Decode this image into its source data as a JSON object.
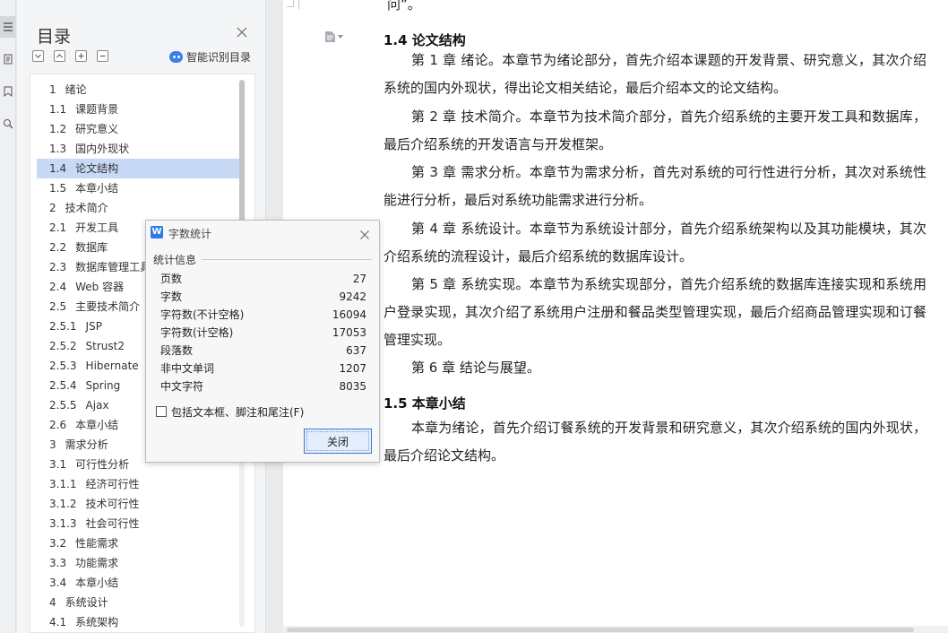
{
  "toc": {
    "title": "目录",
    "smart_label": "智能识别目录",
    "items": [
      {
        "num": "1",
        "text": "绪论",
        "indent": 0
      },
      {
        "num": "1.1",
        "text": "课题背景",
        "indent": 0
      },
      {
        "num": "1.2",
        "text": "研究意义",
        "indent": 0
      },
      {
        "num": "1.3",
        "text": "国内外现状",
        "indent": 0
      },
      {
        "num": "1.4",
        "text": "论文结构",
        "indent": 0,
        "selected": true
      },
      {
        "num": "1.5",
        "text": "本章小结",
        "indent": 0
      },
      {
        "num": "2",
        "text": "技术简介",
        "indent": 0
      },
      {
        "num": "2.1",
        "text": "开发工具",
        "indent": 0
      },
      {
        "num": "2.2",
        "text": "数据库",
        "indent": 0
      },
      {
        "num": "2.3",
        "text": "数据库管理工具",
        "indent": 0
      },
      {
        "num": "2.4",
        "text": "Web 容器",
        "indent": 0
      },
      {
        "num": "2.5",
        "text": "主要技术简介",
        "indent": 0
      },
      {
        "num": "2.5.1",
        "text": "JSP",
        "indent": 0
      },
      {
        "num": "2.5.2",
        "text": "Strust2",
        "indent": 0
      },
      {
        "num": "2.5.3",
        "text": "Hibernate",
        "indent": 0
      },
      {
        "num": "2.5.4",
        "text": "Spring",
        "indent": 0
      },
      {
        "num": "2.5.5",
        "text": "Ajax",
        "indent": 0
      },
      {
        "num": "2.6",
        "text": "本章小结",
        "indent": 0
      },
      {
        "num": "3",
        "text": "需求分析",
        "indent": 0
      },
      {
        "num": "3.1",
        "text": "可行性分析",
        "indent": 0
      },
      {
        "num": "3.1.1",
        "text": "经济可行性",
        "indent": 0
      },
      {
        "num": "3.1.2",
        "text": "技术可行性",
        "indent": 0
      },
      {
        "num": "3.1.3",
        "text": "社会可行性",
        "indent": 0
      },
      {
        "num": "3.2",
        "text": "性能需求",
        "indent": 0
      },
      {
        "num": "3.3",
        "text": "功能需求",
        "indent": 0
      },
      {
        "num": "3.4",
        "text": "本章小结",
        "indent": 0
      },
      {
        "num": "4",
        "text": "系统设计",
        "indent": 0
      },
      {
        "num": "4.1",
        "text": "系统架构",
        "indent": 0
      }
    ]
  },
  "doc": {
    "top_fragment": "问”。",
    "heading_14": "1.4   论文结构",
    "paragraphs": [
      "第 1 章  绪论。本章节为绪论部分，首先介绍本课题的开发背景、研究意义，其次介绍系统的国内外现状，得出论文相关结论，最后介绍本文的论文结构。",
      "第 2 章  技术简介。本章节为技术简介部分，首先介绍系统的主要开发工具和数据库，最后介绍系统的开发语言与开发框架。",
      "第 3 章  需求分析。本章节为需求分析，首先对系统的可行性进行分析，其次对系统性能进行分析，最后对系统功能需求进行分析。",
      "第 4 章  系统设计。本章节为系统设计部分，首先介绍系统架构以及其功能模块，其次介绍系统的流程设计，最后介绍系统的数据库设计。",
      "第 5 章  系统实现。本章节为系统实现部分，首先介绍系统的数据库连接实现和系统用户登录实现，其次介绍了系统用户注册和餐品类型管理实现，最后介绍商品管理实现和订餐管理实现。",
      "第 6 章  结论与展望。"
    ],
    "heading_15": "1.5   本章小结",
    "summary": "本章为绪论，首先介绍订餐系统的开发背景和研究意义，其次介绍系统的国内外现状，最后介绍论文结构。"
  },
  "dialog": {
    "logo": "W",
    "title": "字数统计",
    "group_label": "统计信息",
    "stats": [
      {
        "label": "页数",
        "value": "27"
      },
      {
        "label": "字数",
        "value": "9242"
      },
      {
        "label": "字符数(不计空格)",
        "value": "16094"
      },
      {
        "label": "字符数(计空格)",
        "value": "17053"
      },
      {
        "label": "段落数",
        "value": "637"
      },
      {
        "label": "非中文单词",
        "value": "1207"
      },
      {
        "label": "中文字符",
        "value": "8035"
      }
    ],
    "checkbox_label": "包括文本框、脚注和尾注(F)",
    "close_button": "关闭"
  }
}
